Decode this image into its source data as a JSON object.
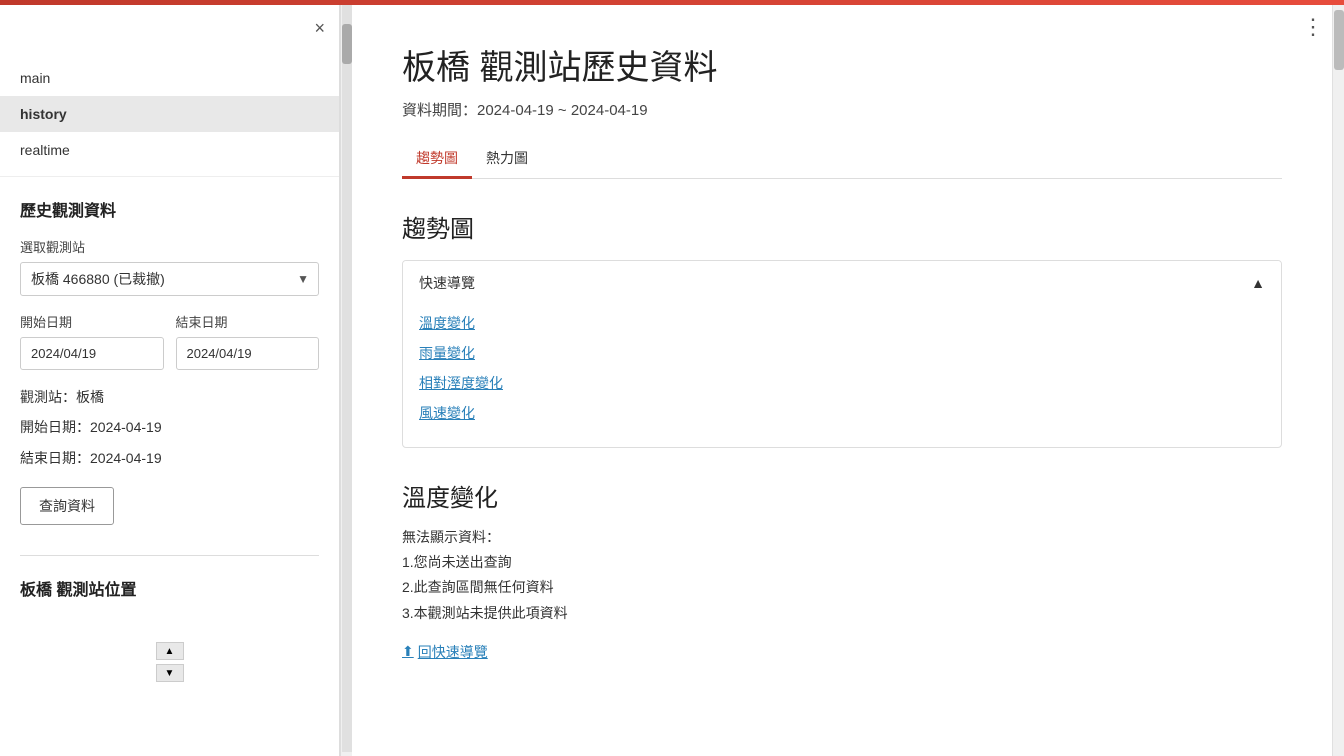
{
  "topbar": {},
  "sidebar": {
    "close_label": "×",
    "nav": {
      "items": [
        {
          "id": "main",
          "label": "main",
          "active": false
        },
        {
          "id": "history",
          "label": "history",
          "active": true
        },
        {
          "id": "realtime",
          "label": "realtime",
          "active": false
        }
      ]
    },
    "section_title": "歷史觀測資料",
    "station_select_label": "選取觀測站",
    "station_selected": "板橋 466880 (已裁撤)",
    "start_date_label": "開始日期",
    "end_date_label": "結束日期",
    "start_date_value": "2024/04/19",
    "end_date_value": "2024/04/19",
    "station_info_label": "觀測站：板橋",
    "start_date_info": "開始日期：2024-04-19",
    "end_date_info": "結束日期：2024-04-19",
    "query_btn_label": "查詢資料",
    "station_position_title": "板橋 觀測站位置"
  },
  "main": {
    "page_title": "板橋 觀測站歷史資料",
    "date_range": "資料期間：2024-04-19 ~ 2024-04-19",
    "tabs": [
      {
        "id": "trend",
        "label": "趨勢圖",
        "active": true
      },
      {
        "id": "heatmap",
        "label": "熱力圖",
        "active": false
      }
    ],
    "trend_section_title": "趨勢圖",
    "quick_nav": {
      "title": "快速導覽",
      "links": [
        {
          "id": "temp",
          "label": "溫度變化"
        },
        {
          "id": "rain",
          "label": "雨量變化"
        },
        {
          "id": "humidity",
          "label": "相對溼度變化"
        },
        {
          "id": "wind",
          "label": "風速變化"
        }
      ]
    },
    "temp_section": {
      "title": "溫度變化",
      "no_data_title": "無法顯示資料：",
      "no_data_reasons": [
        "1.您尚未送出查詢",
        "2.此查詢區間無任何資料",
        "3.本觀測站未提供此項資料"
      ]
    },
    "back_to_top": "回快速導覽",
    "more_options_icon": "⋮"
  }
}
